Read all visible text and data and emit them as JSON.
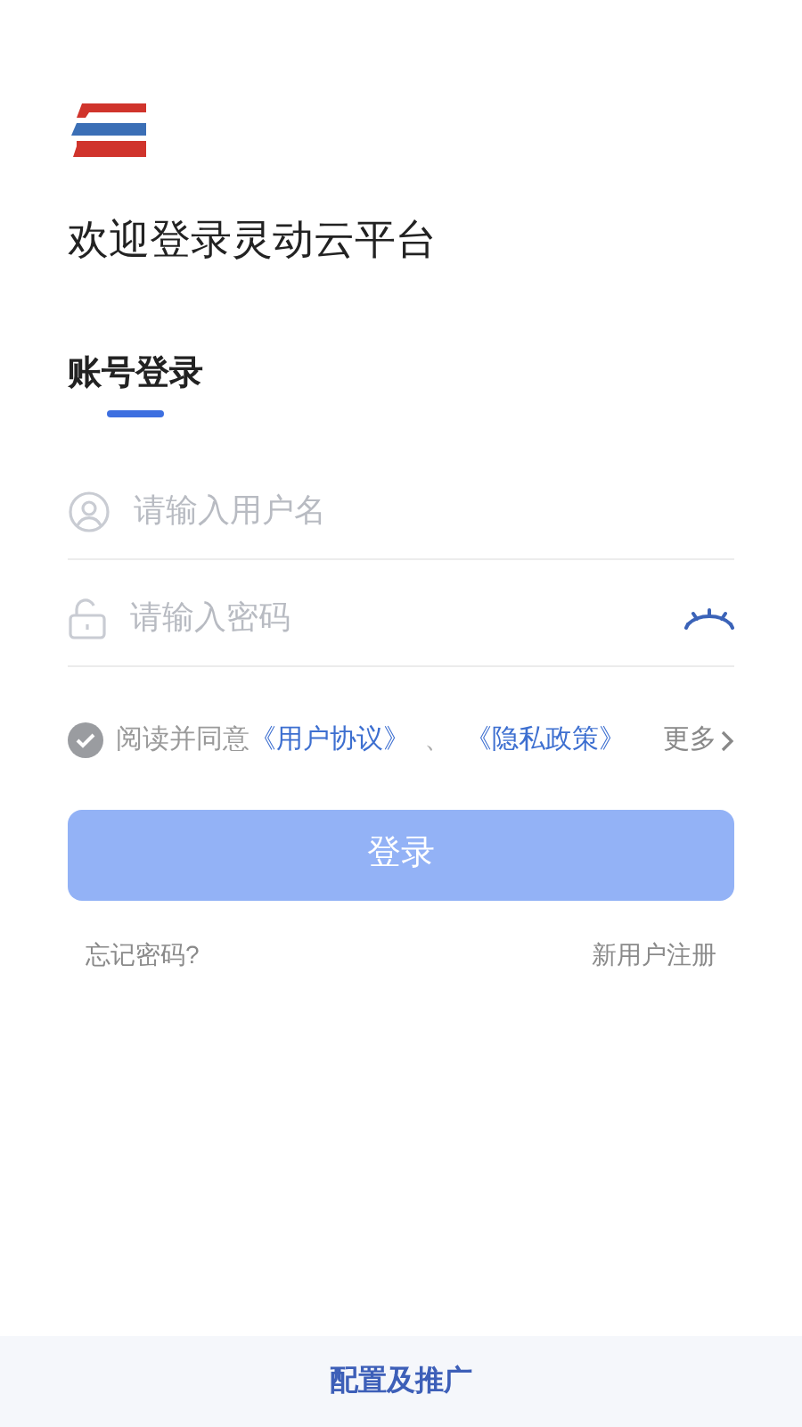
{
  "title": "欢迎登录灵动云平台",
  "tabs": [
    {
      "label": "账号登录",
      "selected": true
    }
  ],
  "fields": [
    {
      "kind": "user",
      "placeholder": "请输入用户名"
    },
    {
      "kind": "password",
      "placeholder": "请输入密码",
      "revealed": false
    }
  ],
  "agreement": {
    "checked": true,
    "text": "阅读并同意",
    "links": [
      "《用户协议》",
      "《隐私政策》"
    ],
    "separator": "、",
    "more": "更多"
  },
  "login_button": {
    "label": "登录",
    "disabled": true
  },
  "links": [
    "忘记密码?",
    "新用户注册"
  ],
  "footer": "配置及推广"
}
